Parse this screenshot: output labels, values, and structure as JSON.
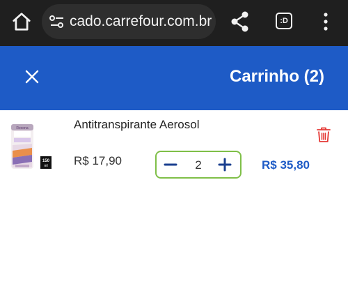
{
  "browser": {
    "url": "cado.carrefour.com.br",
    "tab_indicator": ":D",
    "icons": [
      "home-icon",
      "site-settings-icon",
      "share-icon",
      "tab-switcher-icon",
      "more-menu-icon"
    ]
  },
  "header": {
    "title": "Carrinho (2)",
    "background": "#1e5bc6",
    "close_icon": "close-icon"
  },
  "cart": {
    "items": [
      {
        "name": "Antitranspirante Aerosol",
        "unit_price": "R$ 17,90",
        "quantity": "2",
        "total": "R$ 35,80",
        "image_badge": "150 ml",
        "brand_text": "Rexona"
      }
    ]
  },
  "colors": {
    "accent_blue": "#1e5bc6",
    "stepper_border": "#7fbf48",
    "delete_red": "#e53935"
  }
}
